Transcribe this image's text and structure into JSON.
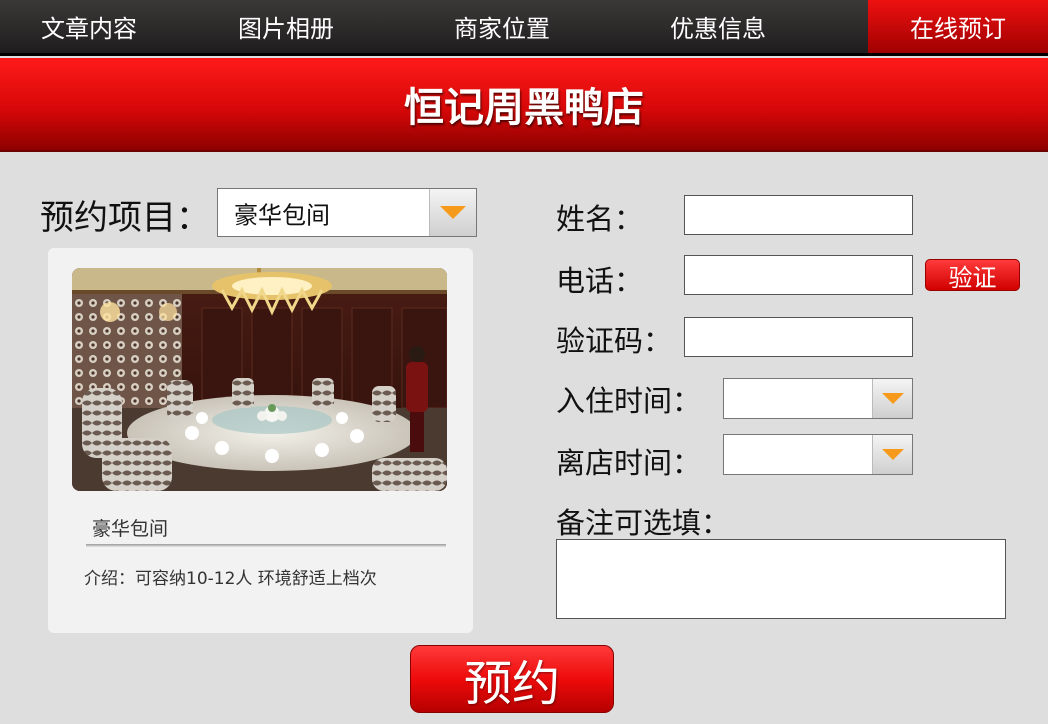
{
  "nav": {
    "tabs": [
      {
        "label": "文章内容"
      },
      {
        "label": "图片相册"
      },
      {
        "label": "商家位置"
      },
      {
        "label": "优惠信息"
      },
      {
        "label": "在线预订"
      }
    ],
    "active_index": 4
  },
  "header": {
    "title": "恒记周黑鸭店"
  },
  "booking": {
    "project_label": "预约项目：",
    "project_value": "豪华包间"
  },
  "room_card": {
    "name": "豪华包间",
    "description": "介绍：可容纳10-12人 环境舒适上档次"
  },
  "form": {
    "name_label": "姓名：",
    "phone_label": "电话：",
    "verify_button": "验证",
    "code_label": "验证码：",
    "checkin_label": "入住时间：",
    "checkout_label": "离店时间：",
    "notes_label": "备注可选填："
  },
  "submit_label": "预约",
  "colors": {
    "accent_red": "#e00000",
    "dropdown_arrow": "#f59a1b",
    "nav_bg": "#2b2929"
  }
}
